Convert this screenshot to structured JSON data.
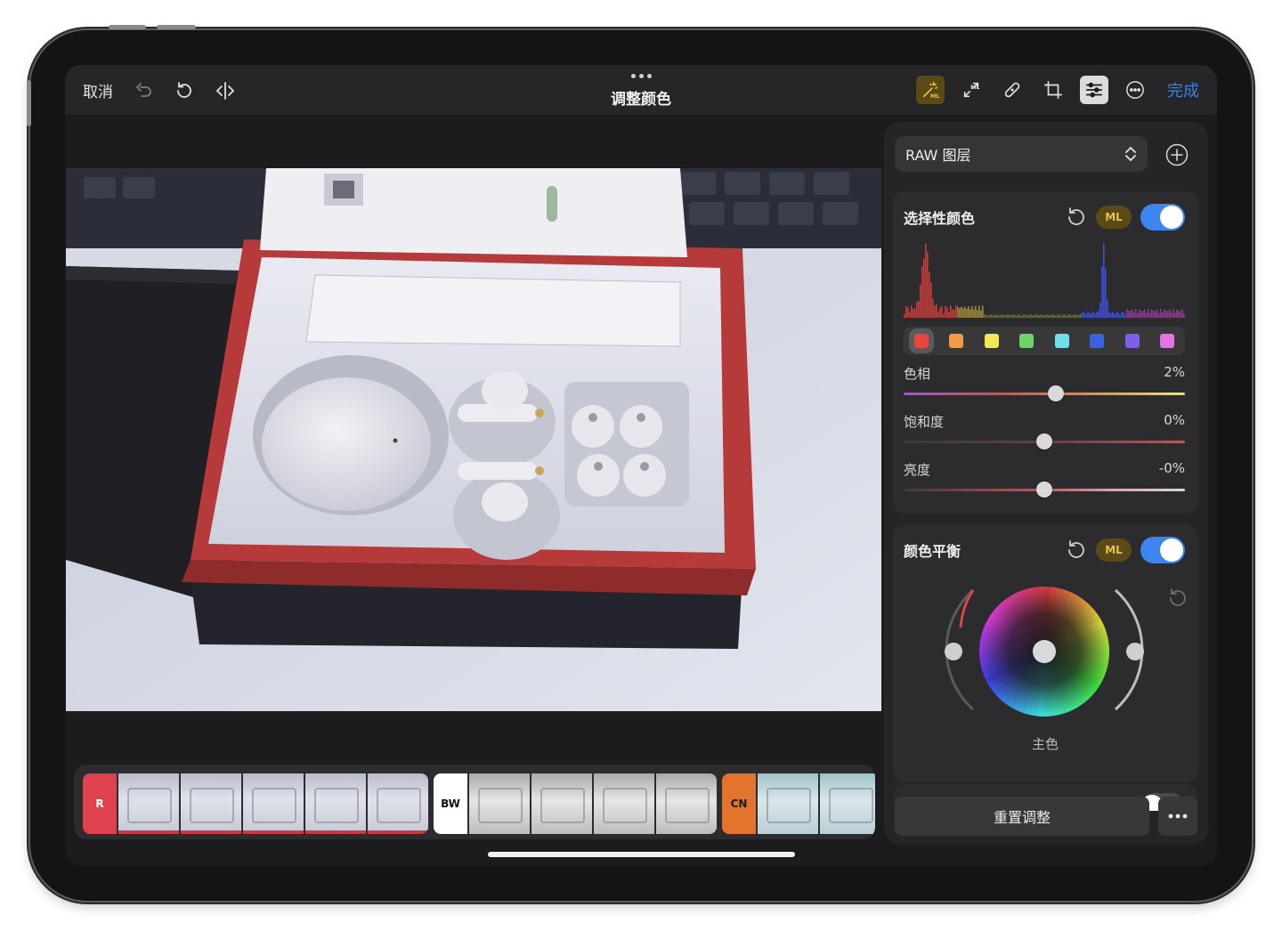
{
  "topbar": {
    "cancel_label": "取消",
    "title": "调整颜色",
    "done_label": "完成",
    "tools": [
      "ml-wand-icon",
      "ml-expand-icon",
      "bandage-icon",
      "crop-icon",
      "sliders-icon",
      "more-circle-icon"
    ]
  },
  "layer": {
    "name": "RAW 图层"
  },
  "selective_color": {
    "title": "选择性颜色",
    "ml_label": "ML",
    "enabled": true,
    "swatches": [
      "#e8453c",
      "#f09a4a",
      "#f2e65a",
      "#6ed36a",
      "#6fe0e8",
      "#3c62e0",
      "#7f5ee8",
      "#e473e6"
    ],
    "selected_swatch": 0,
    "sliders": [
      {
        "label": "色相",
        "value": "2%",
        "level": 0.54
      },
      {
        "label": "饱和度",
        "value": "0%",
        "level": 0.5
      },
      {
        "label": "亮度",
        "value": "-0%",
        "level": 0.5
      }
    ]
  },
  "color_balance": {
    "title": "颜色平衡",
    "ml_label": "ML",
    "enabled": true,
    "wheel_label": "主色"
  },
  "filmstrip": {
    "groups": [
      {
        "label": "R",
        "bg": "#e0414e",
        "fg": "#ffffff",
        "count": 5,
        "style": "r"
      },
      {
        "label": "BW",
        "bg": "#ffffff",
        "fg": "#111111",
        "count": 4,
        "style": "bw"
      },
      {
        "label": "CN",
        "bg": "#e3742e",
        "fg": "#1a1a1a",
        "count": 2,
        "style": "cn"
      }
    ]
  },
  "footer": {
    "reset_label": "重置调整"
  },
  "colors": {
    "accent": "#3f7fe0",
    "toggle_on": "#3d86ef",
    "ml": "#e8c24a"
  }
}
